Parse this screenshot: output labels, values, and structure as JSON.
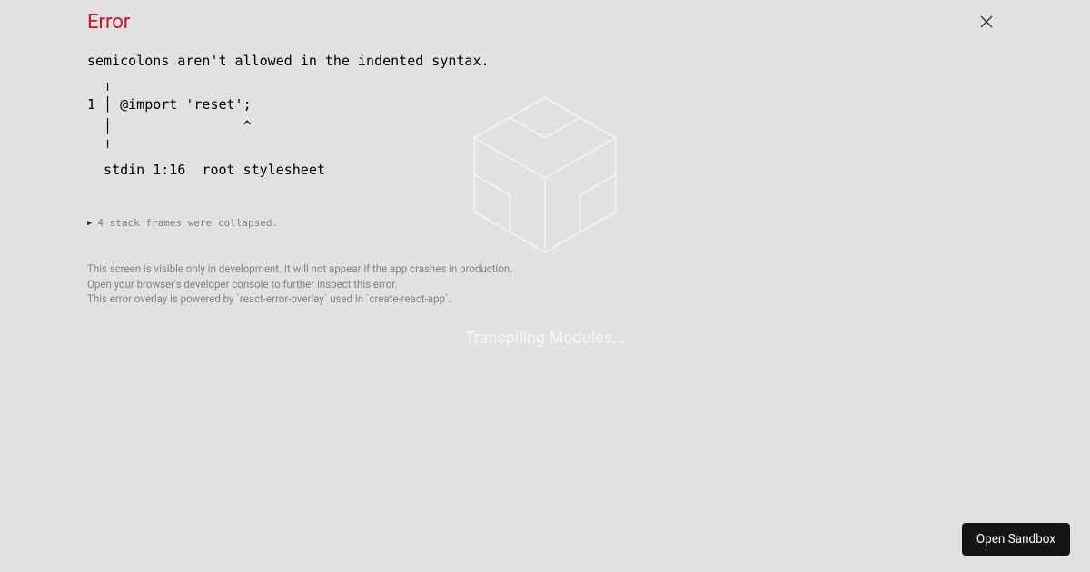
{
  "background": {
    "status_text": "Transpiling Modules..."
  },
  "error": {
    "title": "Error",
    "message": "semicolons aren't allowed in the indented syntax.\n  ╷\n1 │ @import 'reset';\n  │                ^\n  ╵\n  stdin 1:16  root stylesheet",
    "stack_collapse_text": "4 stack frames were collapsed.",
    "footer_line1": "This screen is visible only in development. It will not appear if the app crashes in production.",
    "footer_line2": "Open your browser's developer console to further inspect this error.",
    "footer_line3": "This error overlay is powered by `react-error-overlay` used in `create-react-app`."
  },
  "actions": {
    "open_sandbox_label": "Open Sandbox"
  }
}
